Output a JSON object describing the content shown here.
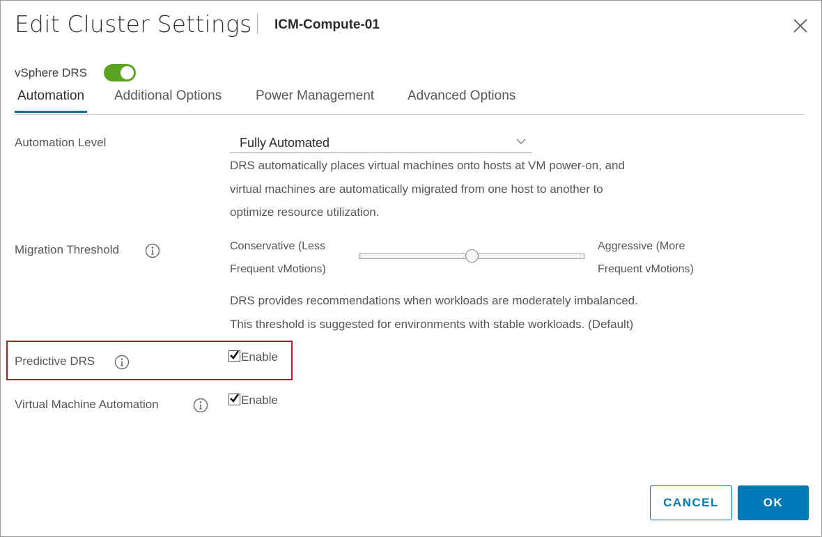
{
  "dialog": {
    "title": "Edit Cluster Settings",
    "subtitle": "ICM-Compute-01"
  },
  "drs": {
    "label": "vSphere DRS",
    "enabled": true
  },
  "tabs": [
    {
      "label": "Automation",
      "active": true
    },
    {
      "label": "Additional Options",
      "active": false
    },
    {
      "label": "Power Management",
      "active": false
    },
    {
      "label": "Advanced Options",
      "active": false
    }
  ],
  "automation_level": {
    "label": "Automation Level",
    "value": "Fully Automated",
    "description": [
      "DRS automatically places virtual machines onto hosts at VM power-on, and",
      "virtual machines are automatically migrated from one host to another to",
      "optimize resource utilization."
    ]
  },
  "migration_threshold": {
    "label": "Migration Threshold",
    "left_label": [
      "Conservative (Less",
      "Frequent vMotions)"
    ],
    "right_label": [
      "Aggressive (More",
      "Frequent vMotions)"
    ],
    "slider_fraction": 0.5,
    "description": [
      "DRS provides recommendations when workloads are moderately imbalanced.",
      "This threshold is suggested for environments with stable workloads. (Default)"
    ]
  },
  "predictive_drs": {
    "label": "Predictive DRS",
    "checkbox_label": "Enable",
    "checked": true
  },
  "vm_automation": {
    "label": "Virtual Machine Automation",
    "checkbox_label": "Enable",
    "checked": true
  },
  "buttons": {
    "cancel": "CANCEL",
    "ok": "OK"
  },
  "colors": {
    "accent": "#0079b8",
    "toggle_on": "#5aa220",
    "highlight": "#b11c1c"
  },
  "icons": {
    "close": "close-icon",
    "info": "info-icon",
    "chevron": "chevron-down-icon",
    "check": "checkmark-icon"
  }
}
